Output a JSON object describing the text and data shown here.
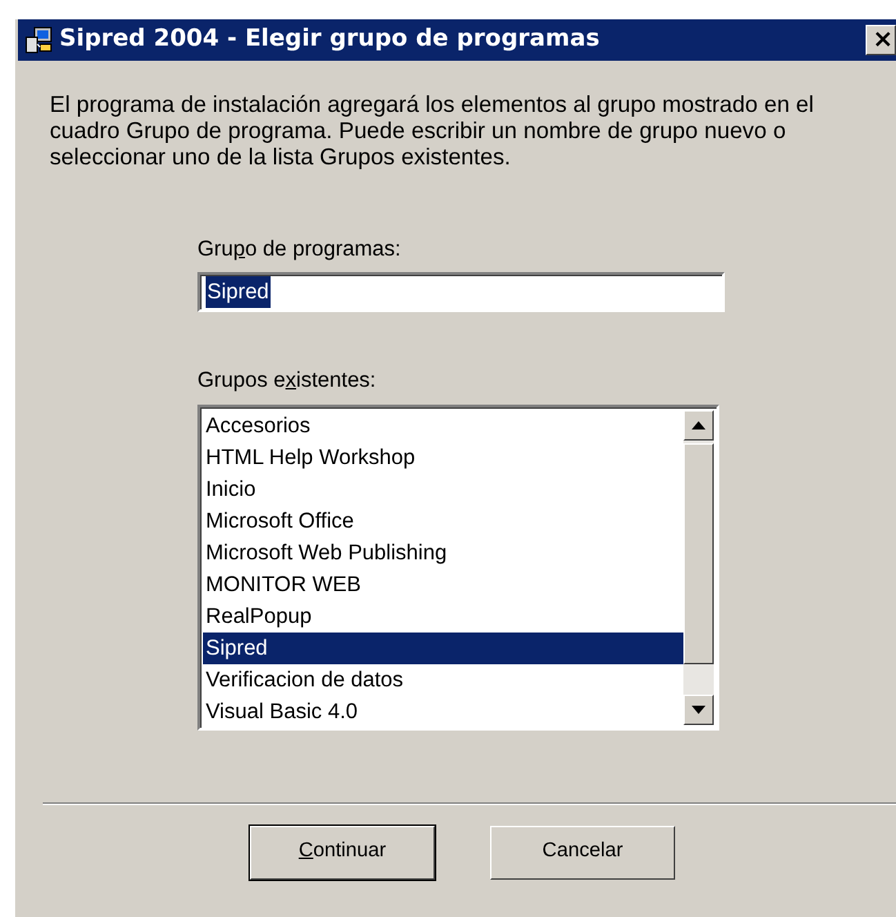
{
  "window": {
    "title": "Sipred 2004 - Elegir grupo de programas",
    "close": "×"
  },
  "description": "El programa de instalación agregará los elementos al grupo mostrado en el cuadro Grupo de programa. Puede escribir un nombre de grupo nuevo o seleccionar uno de la lista Grupos existentes.",
  "program_group": {
    "label": {
      "before": "Gru",
      "key": "p",
      "after": "o de programas:"
    },
    "value": "Sipred",
    "value_selected": true
  },
  "existing_groups": {
    "label": {
      "before": "Grupos e",
      "key": "x",
      "after": "istentes:"
    },
    "items": [
      {
        "text": "Accesorios",
        "selected": false
      },
      {
        "text": "HTML Help Workshop",
        "selected": false
      },
      {
        "text": "Inicio",
        "selected": false
      },
      {
        "text": "Microsoft Office",
        "selected": false
      },
      {
        "text": "Microsoft Web Publishing",
        "selected": false
      },
      {
        "text": "MONITOR WEB",
        "selected": false
      },
      {
        "text": "RealPopup",
        "selected": false
      },
      {
        "text": "Sipred",
        "selected": true
      },
      {
        "text": "Verificacion de datos",
        "selected": false
      },
      {
        "text": "Visual Basic 4.0",
        "selected": false
      }
    ]
  },
  "buttons": [
    {
      "label": {
        "key": "C",
        "after": "ontinuar"
      },
      "default": true
    },
    {
      "label": {
        "before": "Cancelar"
      },
      "default": false
    }
  ]
}
